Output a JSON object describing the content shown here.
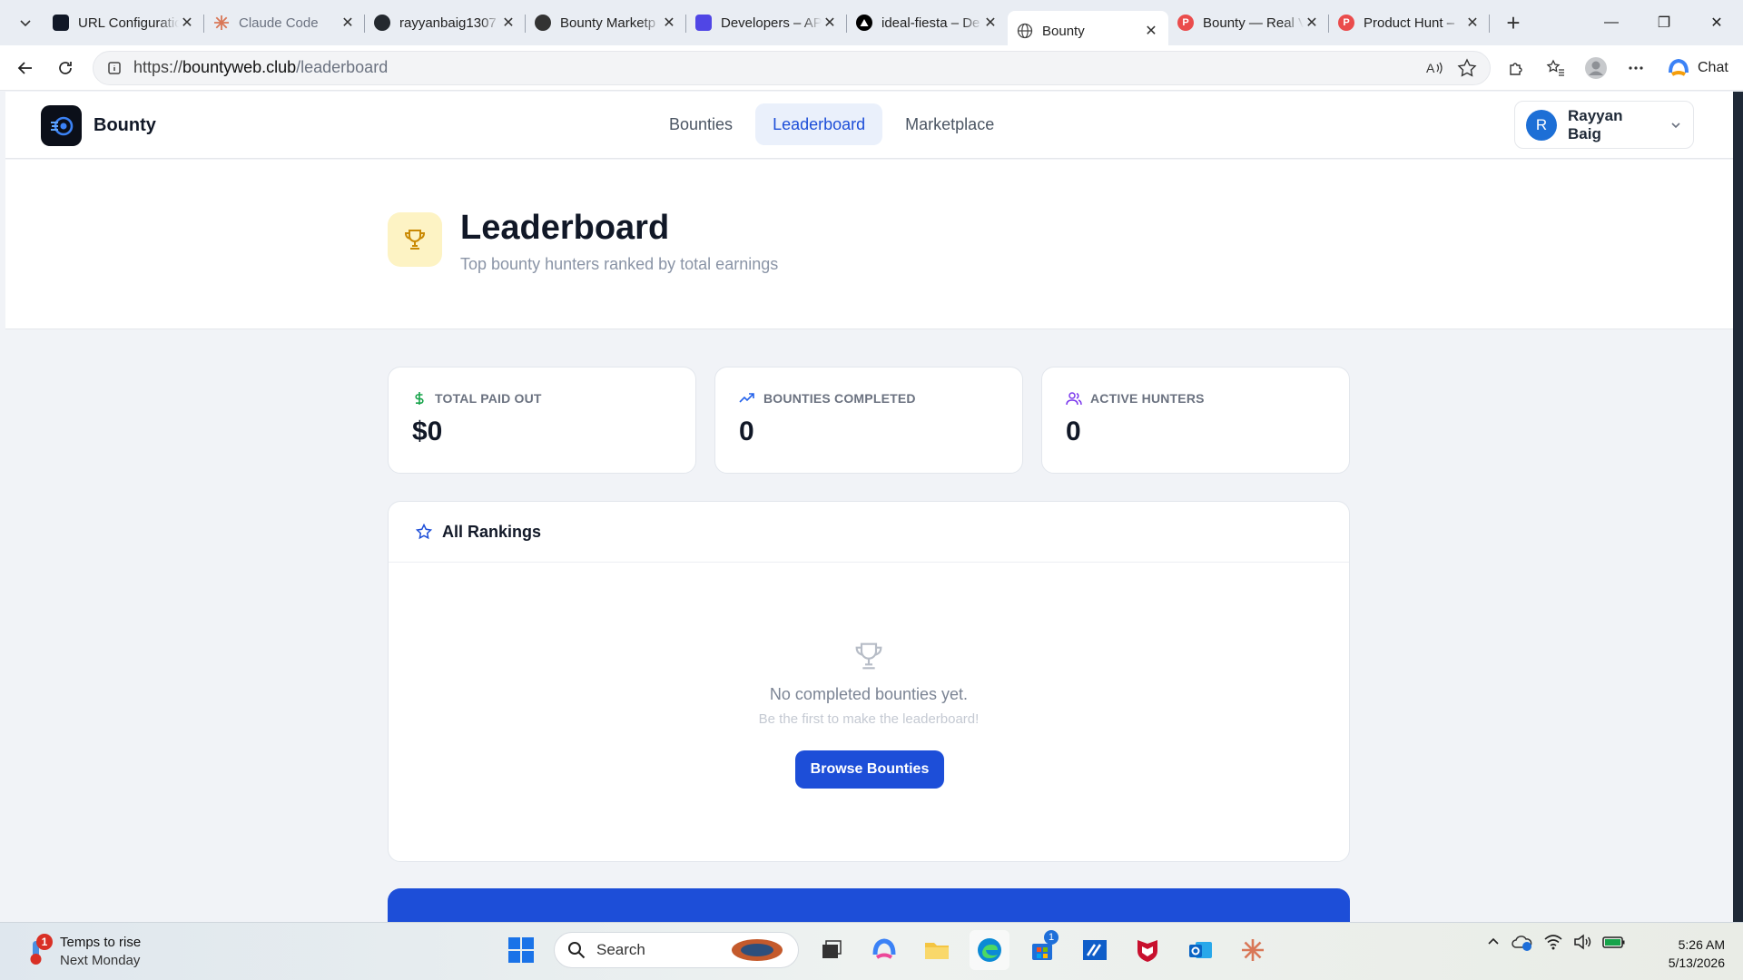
{
  "browser": {
    "tabs": [
      {
        "title": "URL Configuratio",
        "favicon": "activity-icon",
        "color": "#111827"
      },
      {
        "title": "Claude Code",
        "favicon": "claude-icon",
        "color": "#d97757"
      },
      {
        "title": "rayyanbaig1307",
        "favicon": "github-icon",
        "color": "#24292f"
      },
      {
        "title": "Bounty Marketp",
        "favicon": "openai-icon",
        "color": "#333333"
      },
      {
        "title": "Developers – AP",
        "favicon": "developers-icon",
        "color": "#5046e5"
      },
      {
        "title": "ideal-fiesta – De",
        "favicon": "vercel-icon",
        "color": "#000000"
      },
      {
        "title": "Bounty",
        "favicon": "globe-icon",
        "color": "#555555"
      },
      {
        "title": "Bounty — Real V",
        "favicon": "producthunt-icon",
        "color": "#ea4c4c"
      },
      {
        "title": "Product Hunt –",
        "favicon": "producthunt-icon",
        "color": "#ea4c4c"
      }
    ],
    "active_tab": 6,
    "url_prefix": "https://",
    "url_host": "bountyweb.club",
    "url_path": "/leaderboard",
    "chat_label": "Chat"
  },
  "app": {
    "brand": "Bounty",
    "nav": [
      "Bounties",
      "Leaderboard",
      "Marketplace"
    ],
    "active_nav": 1,
    "user": {
      "initial": "R",
      "name": "Rayyan Baig"
    }
  },
  "hero": {
    "title": "Leaderboard",
    "subtitle": "Top bounty hunters ranked by total earnings"
  },
  "stats": [
    {
      "label": "TOTAL PAID OUT",
      "value": "$0",
      "icon": "dollar-icon",
      "color": "#16a34a"
    },
    {
      "label": "BOUNTIES COMPLETED",
      "value": "0",
      "icon": "trending-up-icon",
      "color": "#2563eb"
    },
    {
      "label": "ACTIVE HUNTERS",
      "value": "0",
      "icon": "users-icon",
      "color": "#7c3aed"
    }
  ],
  "rankings": {
    "title": "All Rankings",
    "empty_message": "No completed bounties yet.",
    "empty_hint": "Be the first to make the leaderboard!",
    "button": "Browse Bounties"
  },
  "taskbar": {
    "weather_title": "Temps to rise",
    "weather_sub": "Next Monday",
    "weather_badge": "1",
    "search_label": "Search",
    "store_badge": "1",
    "time": "5:26 AM",
    "date": "5/13/2026"
  }
}
